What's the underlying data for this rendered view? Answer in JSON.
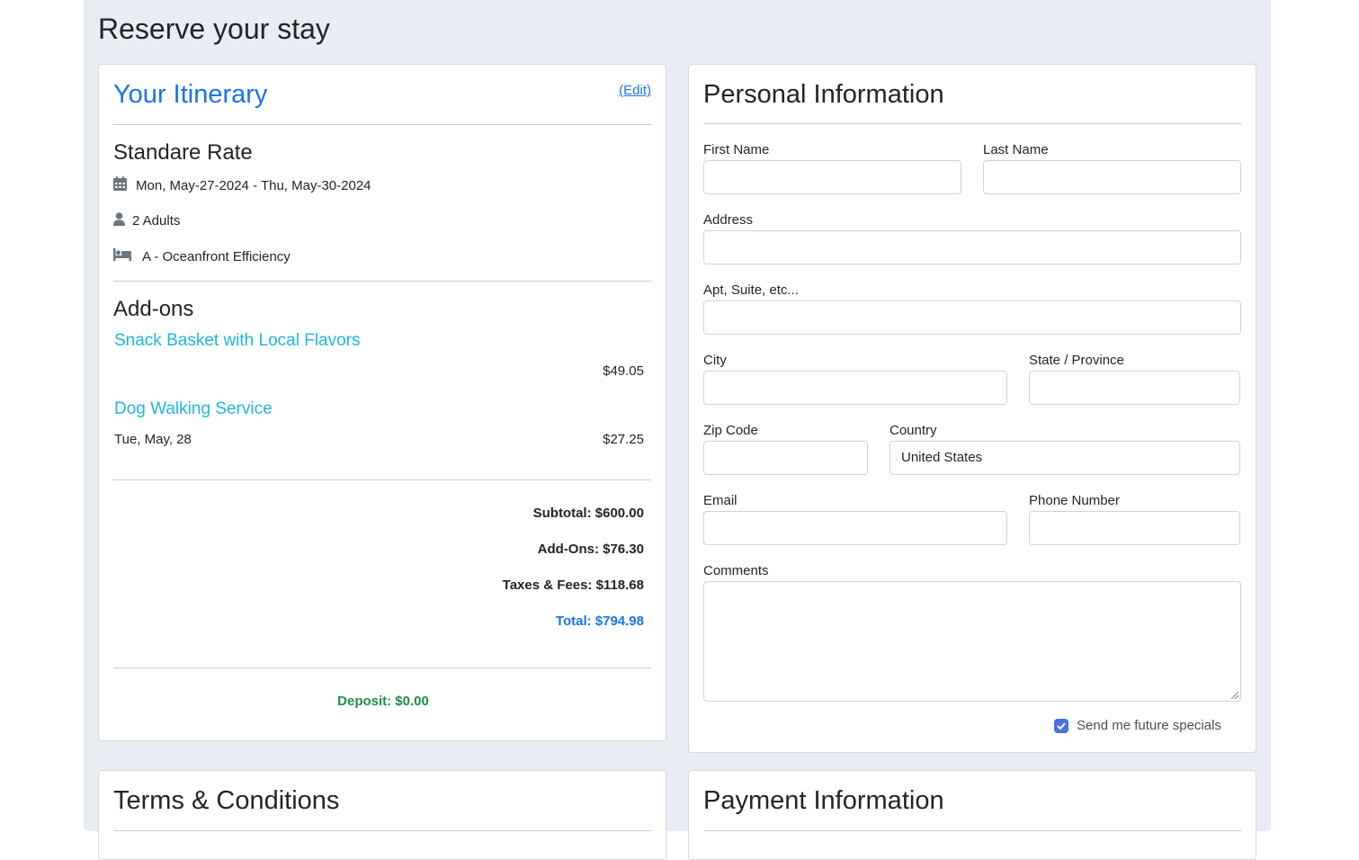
{
  "page": {
    "title": "Reserve your stay"
  },
  "itinerary": {
    "title": "Your Itinerary",
    "edit_label": "(Edit)",
    "rate_name": "Standare Rate",
    "dates": "Mon, May-27-2024 - Thu, May-30-2024",
    "guests": "2 Adults",
    "room": "A - Oceanfront Efficiency",
    "addons_title": "Add-ons",
    "addons": [
      {
        "name": "Snack Basket with Local Flavors",
        "date": "",
        "price": "$49.05"
      },
      {
        "name": "Dog Walking Service",
        "date": "Tue, May, 28",
        "price": "$27.25"
      }
    ],
    "subtotal": "Subtotal: $600.00",
    "addons_total": "Add-Ons: $76.30",
    "taxes": "Taxes & Fees: $118.68",
    "total": "Total: $794.98",
    "deposit": "Deposit: $0.00",
    "icons": {
      "dates": "calendar-icon",
      "guests": "user-icon",
      "room": "bed-icon"
    }
  },
  "personal": {
    "title": "Personal Information",
    "first_name_label": "First Name",
    "last_name_label": "Last Name",
    "address_label": "Address",
    "apt_label": "Apt, Suite, etc...",
    "city_label": "City",
    "state_label": "State / Province",
    "zip_label": "Zip Code",
    "country_label": "Country",
    "country_value": "United States",
    "email_label": "Email",
    "phone_label": "Phone Number",
    "comments_label": "Comments",
    "specials_label": "Send me future specials",
    "specials_checked": true
  },
  "terms": {
    "title": "Terms & Conditions"
  },
  "payment": {
    "title": "Payment Information"
  },
  "colors": {
    "accent": "#1a73e8",
    "addon_link": "#1fb6e0",
    "deposit": "#1e8c4e",
    "background": "#e9ecf3"
  }
}
